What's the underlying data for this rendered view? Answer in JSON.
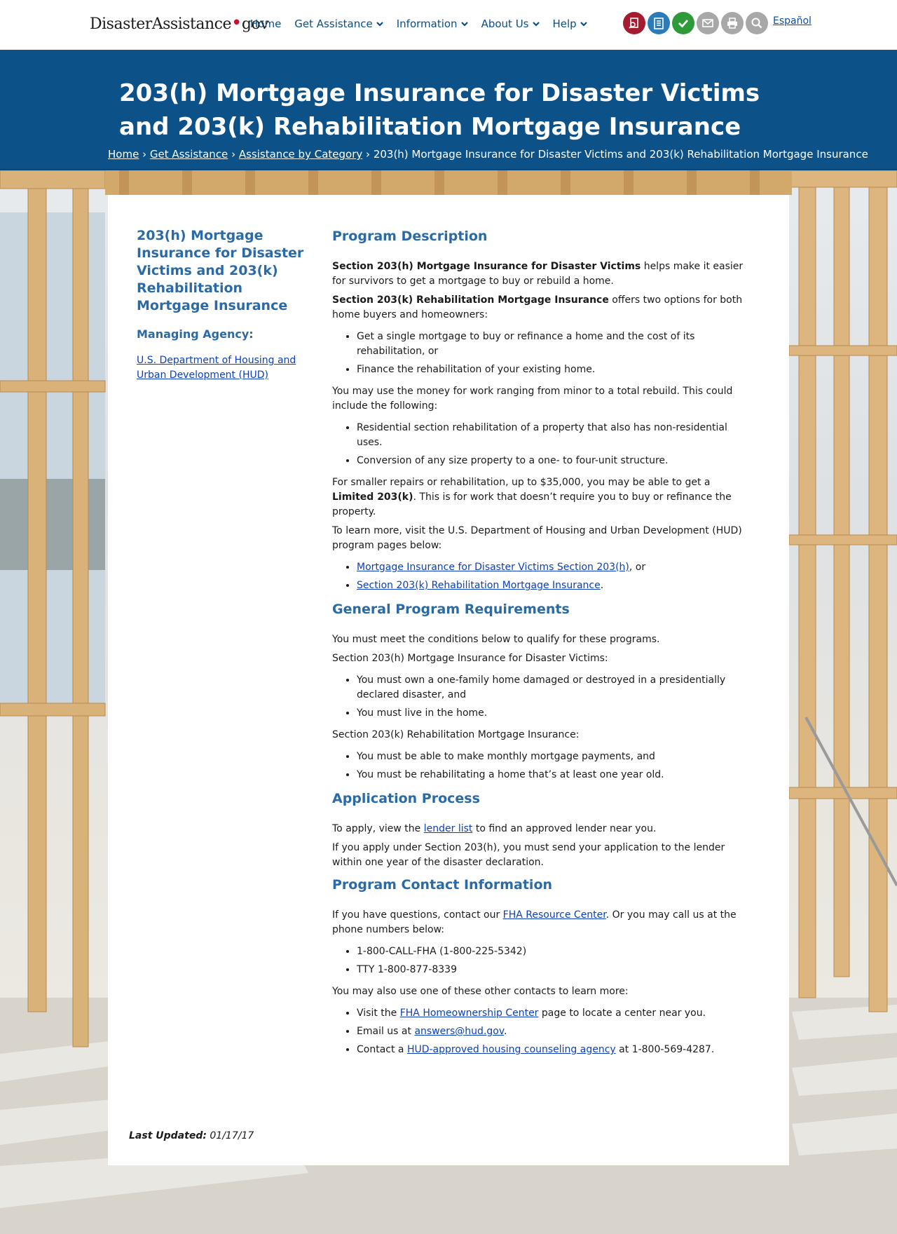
{
  "header": {
    "logo_left": "DisasterAssistance",
    "logo_right": "gov",
    "nav": [
      "Home",
      "Get Assistance",
      "Information",
      "About Us",
      "Help"
    ],
    "espanol": "Español",
    "tool_colors": [
      "#a51c30",
      "#2b7bb9",
      "#2e9a3a",
      "#a8a8a8",
      "#a8a8a8",
      "#a8a8a8"
    ],
    "tool_icons": [
      "search-document-icon",
      "checklist-icon",
      "check-icon",
      "email-icon",
      "print-icon",
      "search-icon"
    ]
  },
  "banner": {
    "title": "203(h) Mortgage Insurance for Disaster Victims and 203(k) Rehabilitation Mortgage Insurance",
    "breadcrumb": [
      "Home",
      "Get Assistance",
      "Assistance by Category"
    ],
    "breadcrumb_current": "203(h) Mortgage Insurance for Disaster Victims and 203(k) Rehabilitation Mortgage Insurance"
  },
  "sidebar": {
    "title": "203(h) Mortgage Insurance for Disaster Victims and 203(k) Rehabilitation Mortgage Insurance",
    "agency_label": "Managing Agency:",
    "agency_link": "U.S. Department of Housing and Urban Development (HUD)"
  },
  "content": {
    "h_description": "Program Description",
    "p1_bold": "Section 203(h) Mortgage Insurance for Disaster Victims",
    "p1_rest": " helps make it easier for survivors to get a mortgage to buy or rebuild a home.",
    "p2_bold": "Section 203(k) Rehabilitation Mortgage Insurance",
    "p2_rest": " offers two options for both home buyers and homeowners:",
    "list1": [
      "Get a single mortgage to buy or refinance a home and the cost of its rehabilitation, or",
      "Finance the rehabilitation of your existing home."
    ],
    "p3": "You may use the money for work ranging from minor to a total rebuild. This could include the following:",
    "list2": [
      "Residential section rehabilitation of a property that also has non-residential uses.",
      "Conversion of any size property to a one- to four-unit structure."
    ],
    "p4_a": "For smaller repairs or rehabilitation, up to $35,000, you may be able to get a ",
    "p4_bold": "Limited 203(k)",
    "p4_b": ". This is for work that doesn’t require you to buy or refinance the property.",
    "p5": "To learn more, visit the U.S. Department of Housing and Urban Development (HUD) program pages below:",
    "link1": "Mortgage Insurance for Disaster Victims Section 203(h)",
    "link1_suffix": ", or",
    "link2": "Section 203(k) Rehabilitation Mortgage Insurance",
    "link2_suffix": ".",
    "h_requirements": "General Program Requirements",
    "r1": "You must meet the conditions below to qualify for these programs.",
    "r2": "Section 203(h) Mortgage Insurance for Disaster Victims:",
    "list3": [
      "You must own a one-family home damaged or destroyed in a presidentially declared disaster, and",
      "You must live in the home."
    ],
    "r3": "Section 203(k) Rehabilitation Mortgage Insurance:",
    "list4": [
      "You must be able to make monthly mortgage payments, and",
      "You must be rehabilitating a home that’s at least one year old."
    ],
    "h_application": "Application Process",
    "a1_pre": "To apply, view the ",
    "a1_link": "lender list",
    "a1_post": " to find an approved lender near you.",
    "a2": "If you apply under Section 203(h), you must send your application to the lender within one year of the disaster declaration.",
    "h_contact": "Program Contact Information",
    "c1_pre": "If you have questions, contact our ",
    "c1_link": "FHA Resource Center",
    "c1_post": ". Or you may call us at the phone numbers below:",
    "phones": [
      "1-800-CALL-FHA (1-800-225-5342)",
      "TTY 1-800-877-8339"
    ],
    "c2": "You may also use one of these other contacts to learn more:",
    "o1_pre": "Visit the ",
    "o1_link": "FHA Homeownership Center",
    "o1_post": " page to locate a center near you.",
    "o2_pre": "Email us at ",
    "o2_link": "answers@hud.gov",
    "o2_post": ".",
    "o3_pre": "Contact a ",
    "o3_link": "HUD-approved housing counseling agency",
    "o3_post": " at 1-800-569-4287."
  },
  "footer": {
    "updated_label": "Last Updated:",
    "updated_value": "01/17/17"
  }
}
